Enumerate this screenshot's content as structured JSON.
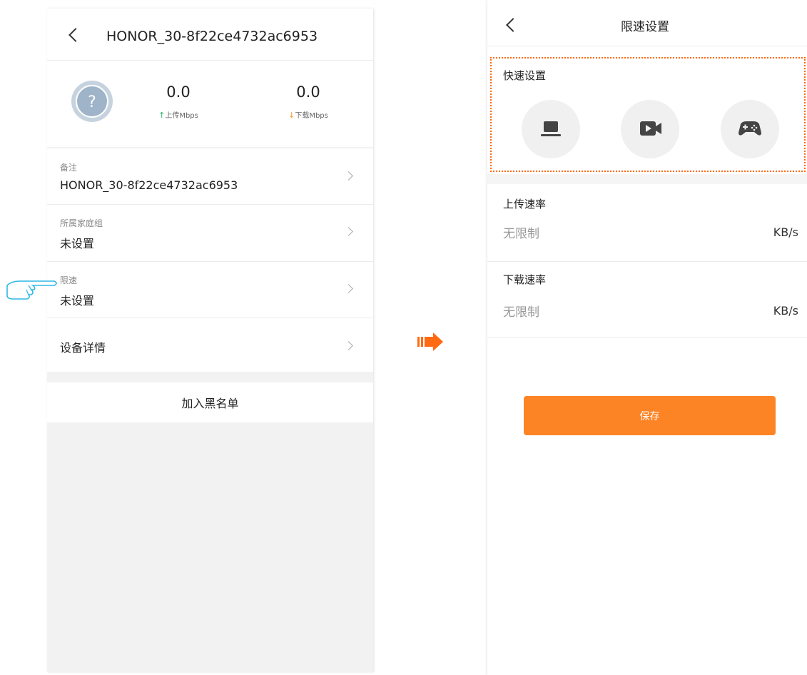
{
  "left_screen": {
    "device_name": "HONOR_30-8f22ce4732ac6953",
    "upload": {
      "value": "0.0",
      "label": "上传Mbps"
    },
    "download": {
      "value": "0.0",
      "label": "下载Mbps"
    },
    "rows": [
      {
        "label": "备注",
        "value": "HONOR_30-8f22ce4732ac6953"
      },
      {
        "label": "所属家庭组",
        "value": "未设置"
      },
      {
        "label": "限速",
        "value": "未设置"
      },
      {
        "value": "设备详情"
      }
    ],
    "blacklist_button": "加入黑名单"
  },
  "right_screen": {
    "title": "限速设置",
    "quick_settings_label": "快速设置",
    "quick_icons": [
      "laptop-icon",
      "video-icon",
      "gamepad-icon"
    ],
    "upload_label": "上传速率",
    "upload_placeholder": "无限制",
    "upload_unit": "KB/s",
    "download_label": "下载速率",
    "download_placeholder": "无限制",
    "download_unit": "KB/s",
    "save_button": "保存"
  },
  "colors": {
    "accent_orange": "#fd8425",
    "dotted_highlight": "#ff6a13",
    "pointer_hand": "#2fb8e6",
    "upload_arrow": "#23b36b",
    "download_arrow": "#f39a22",
    "avatar": "#9fb4c9"
  }
}
